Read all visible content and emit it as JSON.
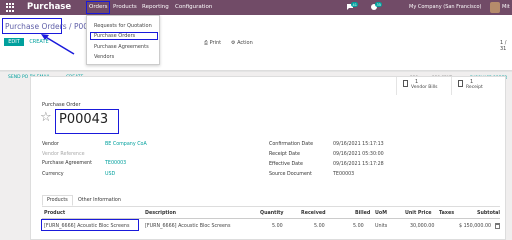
{
  "navbar": {
    "app_name": "Purchase",
    "menu": [
      "Orders",
      "Products",
      "Reporting",
      "Configuration"
    ],
    "chat_badge": "41",
    "activity_badge": "35",
    "company": "My Company (San Francisco)",
    "user": "Mit"
  },
  "orders_menu": {
    "items": [
      "Requests for Quotation",
      "Purchase Orders",
      "Purchase Agreements",
      "Vendors"
    ]
  },
  "control_panel": {
    "breadcrumb_parent": "Purchase Orders",
    "breadcrumb_sep": " / ",
    "breadcrumb_current": "P000",
    "edit_label": "EDIT",
    "create_label": "CREATE",
    "print_label": "Print",
    "action_label": "Action",
    "pager": "1 / 31"
  },
  "statusbar": {
    "send_po": "SEND PO BY EMAIL",
    "create_bill": "CREATE",
    "stages": [
      "RFQ",
      "RFQ SENT",
      "PURCHASE ORDER"
    ]
  },
  "smart_buttons": [
    {
      "count": "1",
      "label": "Vendor Bills"
    },
    {
      "count": "1",
      "label": "Receipt"
    }
  ],
  "form": {
    "title_label": "Purchase Order",
    "name": "P00043",
    "left_fields": [
      {
        "label": "Vendor",
        "value": "BE Company CoA"
      },
      {
        "label": "Vendor Reference",
        "value": ""
      },
      {
        "label": "Purchase Agreement",
        "value": "TE00003"
      },
      {
        "label": "Currency",
        "value": "USD"
      }
    ],
    "right_fields": [
      {
        "label": "Confirmation Date",
        "value": "09/16/2021 15:17:13"
      },
      {
        "label": "Receipt Date",
        "value": "09/16/2021 05:30:00"
      },
      {
        "label": "Effective Date",
        "value": "09/16/2021 15:17:28"
      },
      {
        "label": "Source Document",
        "value": "TE00003"
      }
    ]
  },
  "tabs": [
    "Products",
    "Other Information"
  ],
  "table": {
    "headers": [
      "Product",
      "Description",
      "Quantity",
      "Received",
      "Billed",
      "UoM",
      "Unit Price",
      "Taxes",
      "Subtotal"
    ],
    "rows": [
      [
        "[FURN_6666] Acoustic Bloc Screens",
        "[FURN_6666] Acoustic Bloc Screens",
        "5.00",
        "5.00",
        "5.00",
        "Units",
        "30,000.00",
        "",
        "$ 150,000.00"
      ]
    ]
  },
  "colors": {
    "navbar": "#714b67",
    "accent": "#00a09d",
    "highlight_border": "#1a1adb"
  }
}
